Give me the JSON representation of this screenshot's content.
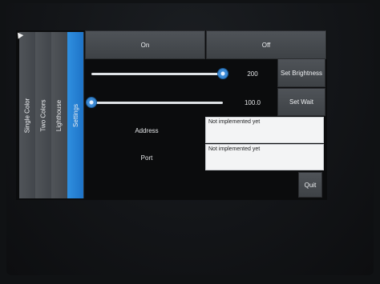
{
  "tabs": [
    {
      "label": "Single Color"
    },
    {
      "label": "Two Colors"
    },
    {
      "label": "Lighthouse"
    },
    {
      "label": "Settings"
    }
  ],
  "power": {
    "on_label": "On",
    "off_label": "Off"
  },
  "brightness": {
    "value": "200",
    "button": "Set Brightness",
    "fraction": 1.0
  },
  "wait": {
    "value": "100.0",
    "button": "Set Wait",
    "fraction": 0.0
  },
  "address": {
    "label": "Address",
    "text": "Not implemented yet"
  },
  "port": {
    "label": "Port",
    "text": "Not implemented yet"
  },
  "quit": {
    "label": "Quit"
  },
  "colors": {
    "active_tab": "#2a86d8",
    "background": "#0b0c0d"
  }
}
